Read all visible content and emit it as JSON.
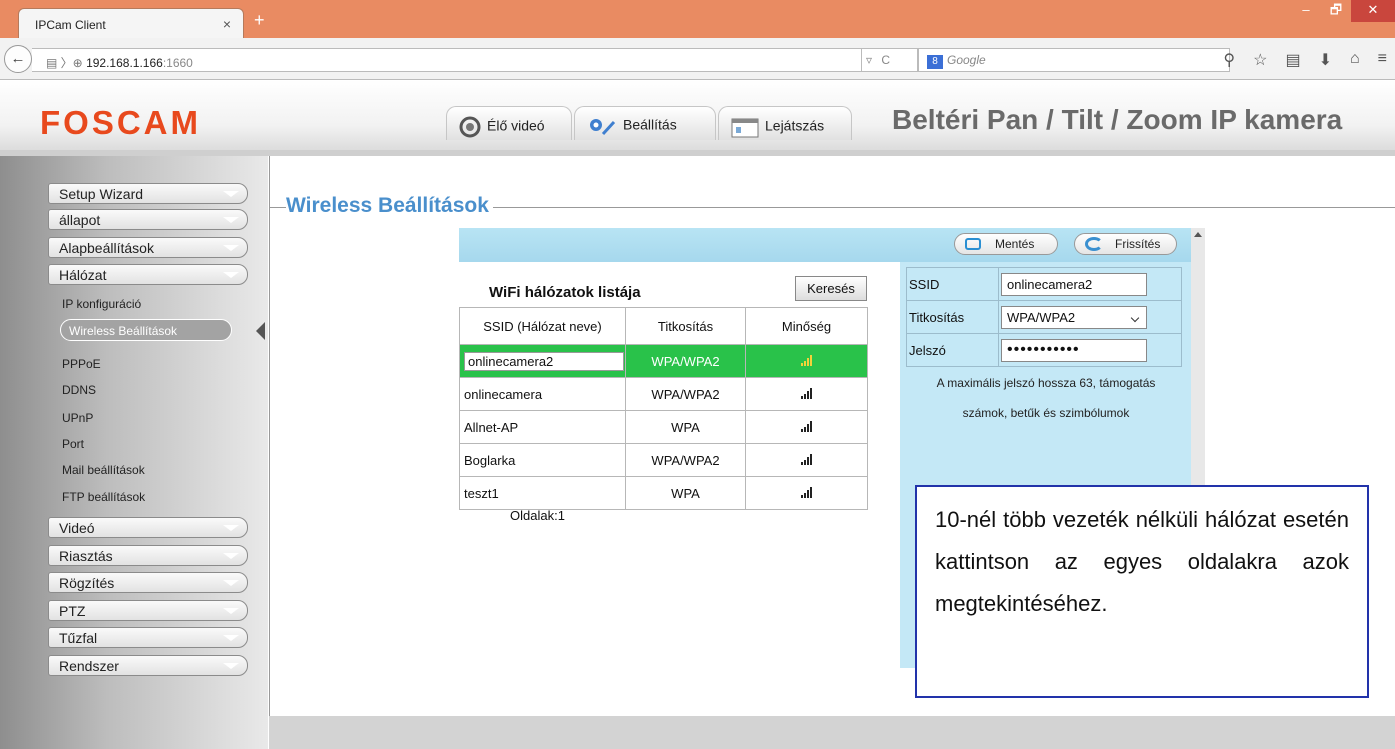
{
  "browser": {
    "tab_title": "IPCam Client",
    "tab_close": "×",
    "new_tab": "+",
    "url_host": "192.168.1.166",
    "url_port": ":1660",
    "search_placeholder": "Google",
    "window_controls": [
      "–",
      "🗗",
      "✕"
    ]
  },
  "header": {
    "logo": "FOSCAM",
    "tabs": [
      {
        "label": "Élő videó",
        "icon": "live-video-icon"
      },
      {
        "label": "Beállítás",
        "icon": "settings-gears-icon"
      },
      {
        "label": "Lejátszás",
        "icon": "calendar-playback-icon"
      }
    ],
    "title": "Beltéri Pan / Tilt / Zoom IP kamera"
  },
  "sidebar": {
    "main_items_top": [
      "Setup Wizard",
      "állapot",
      "Alapbeállítások",
      "Hálózat"
    ],
    "sub_items": [
      "IP konfiguráció",
      "Wireless Beállítások",
      "PPPoE",
      "DDNS",
      "UPnP",
      "Port",
      "Mail beállítások",
      "FTP beállítások"
    ],
    "active_sub": "Wireless Beállítások",
    "main_items_bottom": [
      "Videó",
      "Riasztás",
      "Rögzítés",
      "PTZ",
      "Tűzfal",
      "Rendszer"
    ]
  },
  "page": {
    "title": "Wireless Beállítások",
    "save_label": "Mentés",
    "refresh_label": "Frissítés"
  },
  "wifi_list": {
    "title": "WiFi hálózatok listája",
    "search_button": "Keresés",
    "columns": [
      "SSID (Hálózat neve)",
      "Titkosítás",
      "Minőség"
    ],
    "rows": [
      {
        "ssid": "onlinecamera2",
        "encryption": "WPA/WPA2",
        "quality": 4,
        "selected": true
      },
      {
        "ssid": "onlinecamera",
        "encryption": "WPA/WPA2",
        "quality": 4,
        "selected": false
      },
      {
        "ssid": "Allnet-AP",
        "encryption": "WPA",
        "quality": 4,
        "selected": false
      },
      {
        "ssid": "Boglarka",
        "encryption": "WPA/WPA2",
        "quality": 4,
        "selected": false
      },
      {
        "ssid": "teszt1",
        "encryption": "WPA",
        "quality": 4,
        "selected": false
      }
    ],
    "pages": "Oldalak:1"
  },
  "form": {
    "ssid_label": "SSID",
    "ssid_value": "onlinecamera2",
    "encryption_label": "Titkosítás",
    "encryption_value": "WPA/WPA2",
    "password_label": "Jelszó",
    "password_value": "•••••••••••",
    "note_line1": "A maximális jelszó hossza 63, támogatás",
    "note_line2": "számok, betűk és szimbólumok"
  },
  "callout": {
    "text": "10-nél több vezeték nélküli hálózat esetén kattintson az egyes oldalakra azok megtekintéséhez."
  },
  "colors": {
    "accent_blue": "#4a8fcc",
    "selected_row": "#29c24a",
    "logo": "#e8491d",
    "panel_blue": "#c4e8f6"
  }
}
